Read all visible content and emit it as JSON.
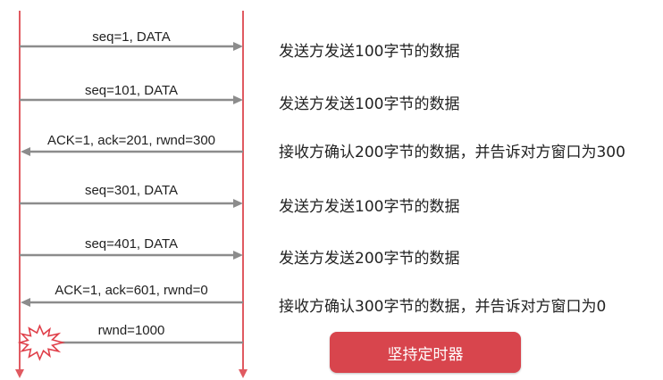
{
  "colors": {
    "lifeline": "#e05a61",
    "arrow": "#8c8c8c",
    "timer_badge": "#d8454d",
    "burst_fill": "#ffffff",
    "burst_stroke": "#e0404a"
  },
  "messages": [
    {
      "label": "seq=1, DATA",
      "direction": "right",
      "note": "发送方发送100字节的数据"
    },
    {
      "label": "seq=101, DATA",
      "direction": "right",
      "note": "发送方发送100字节的数据"
    },
    {
      "label": "ACK=1, ack=201, rwnd=300",
      "direction": "left",
      "note": "接收方确认200字节的数据，并告诉对方窗口为300"
    },
    {
      "label": "seq=301, DATA",
      "direction": "right",
      "note": "发送方发送100字节的数据"
    },
    {
      "label": "seq=401, DATA",
      "direction": "right",
      "note": "发送方发送200字节的数据"
    },
    {
      "label": "ACK=1, ack=601, rwnd=0",
      "direction": "left",
      "note": "接收方确认300字节的数据，并告诉对方窗口为0"
    },
    {
      "label": "rwnd=1000",
      "direction": "left",
      "lost": true
    }
  ],
  "timer_label": "坚持定时器"
}
